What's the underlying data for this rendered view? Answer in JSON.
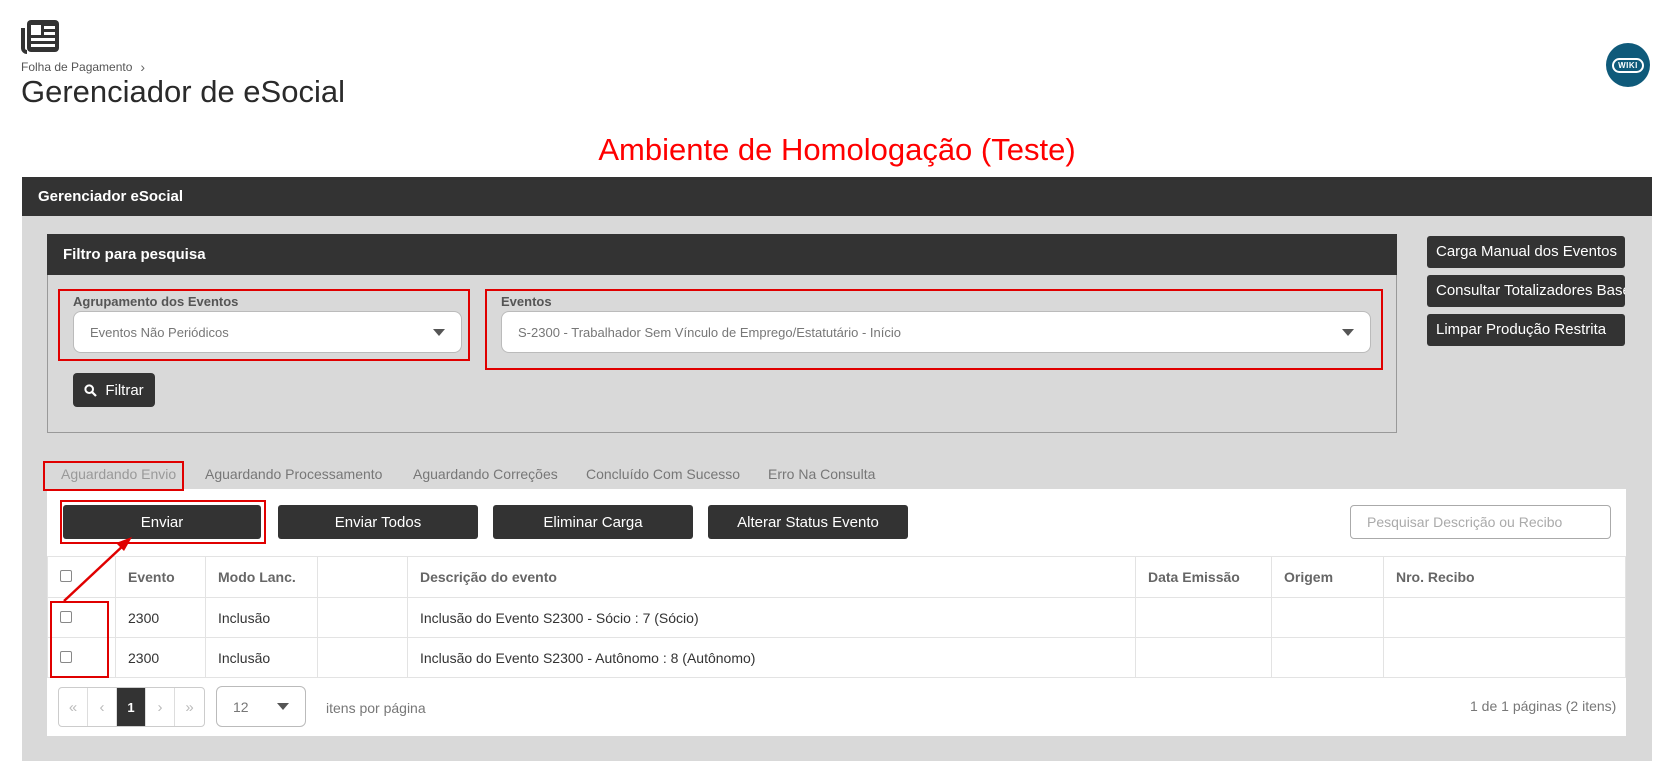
{
  "header": {
    "breadcrumb": "Folha de Pagamento",
    "title": "Gerenciador de eSocial",
    "wiki_label": "WIKI",
    "environment_banner": "Ambiente de Homologação (Teste)"
  },
  "panel": {
    "title": "Gerenciador eSocial"
  },
  "filter": {
    "title": "Filtro para pesquisa",
    "grouping_label": "Agrupamento dos Eventos",
    "grouping_value": "Eventos Não Periódicos",
    "events_label": "Eventos",
    "events_value": "S-2300 - Trabalhador Sem Vínculo de Emprego/Estatutário - Início",
    "filter_button": "Filtrar"
  },
  "side_buttons": [
    "Carga Manual dos Eventos",
    "Consultar Totalizadores Base",
    "Limpar Produção Restrita"
  ],
  "tabs": [
    "Aguardando Envio",
    "Aguardando Processamento",
    "Aguardando Correções",
    "Concluído Com Sucesso",
    "Erro Na Consulta"
  ],
  "actions": {
    "send": "Enviar",
    "send_all": "Enviar Todos",
    "delete_load": "Eliminar Carga",
    "change_status": "Alterar Status Evento",
    "search_placeholder": "Pesquisar Descrição ou Recibo"
  },
  "table": {
    "columns": [
      "Evento",
      "Modo Lanc.",
      "",
      "Descrição do evento",
      "Data Emissão",
      "Origem",
      "Nro. Recibo"
    ],
    "rows": [
      {
        "evento": "2300",
        "modo": "Inclusão",
        "extra": "",
        "descricao": "Inclusão do Evento S2300 - Sócio : 7 (Sócio)",
        "data": "",
        "origem": "",
        "recibo": ""
      },
      {
        "evento": "2300",
        "modo": "Inclusão",
        "extra": "",
        "descricao": "Inclusão do Evento S2300 - Autônomo : 8 (Autônomo)",
        "data": "",
        "origem": "",
        "recibo": ""
      }
    ]
  },
  "pagination": {
    "first": "«",
    "prev": "‹",
    "current": "1",
    "next": "›",
    "last": "»",
    "per_page": "12",
    "per_page_label": "itens por página",
    "info": "1 de 1 páginas (2 itens)"
  },
  "colors": {
    "accent_dark": "#333333",
    "annotation_red": "#e00000",
    "panel_bg": "#d9d9d9",
    "wiki_bg": "#0f5a7a"
  }
}
